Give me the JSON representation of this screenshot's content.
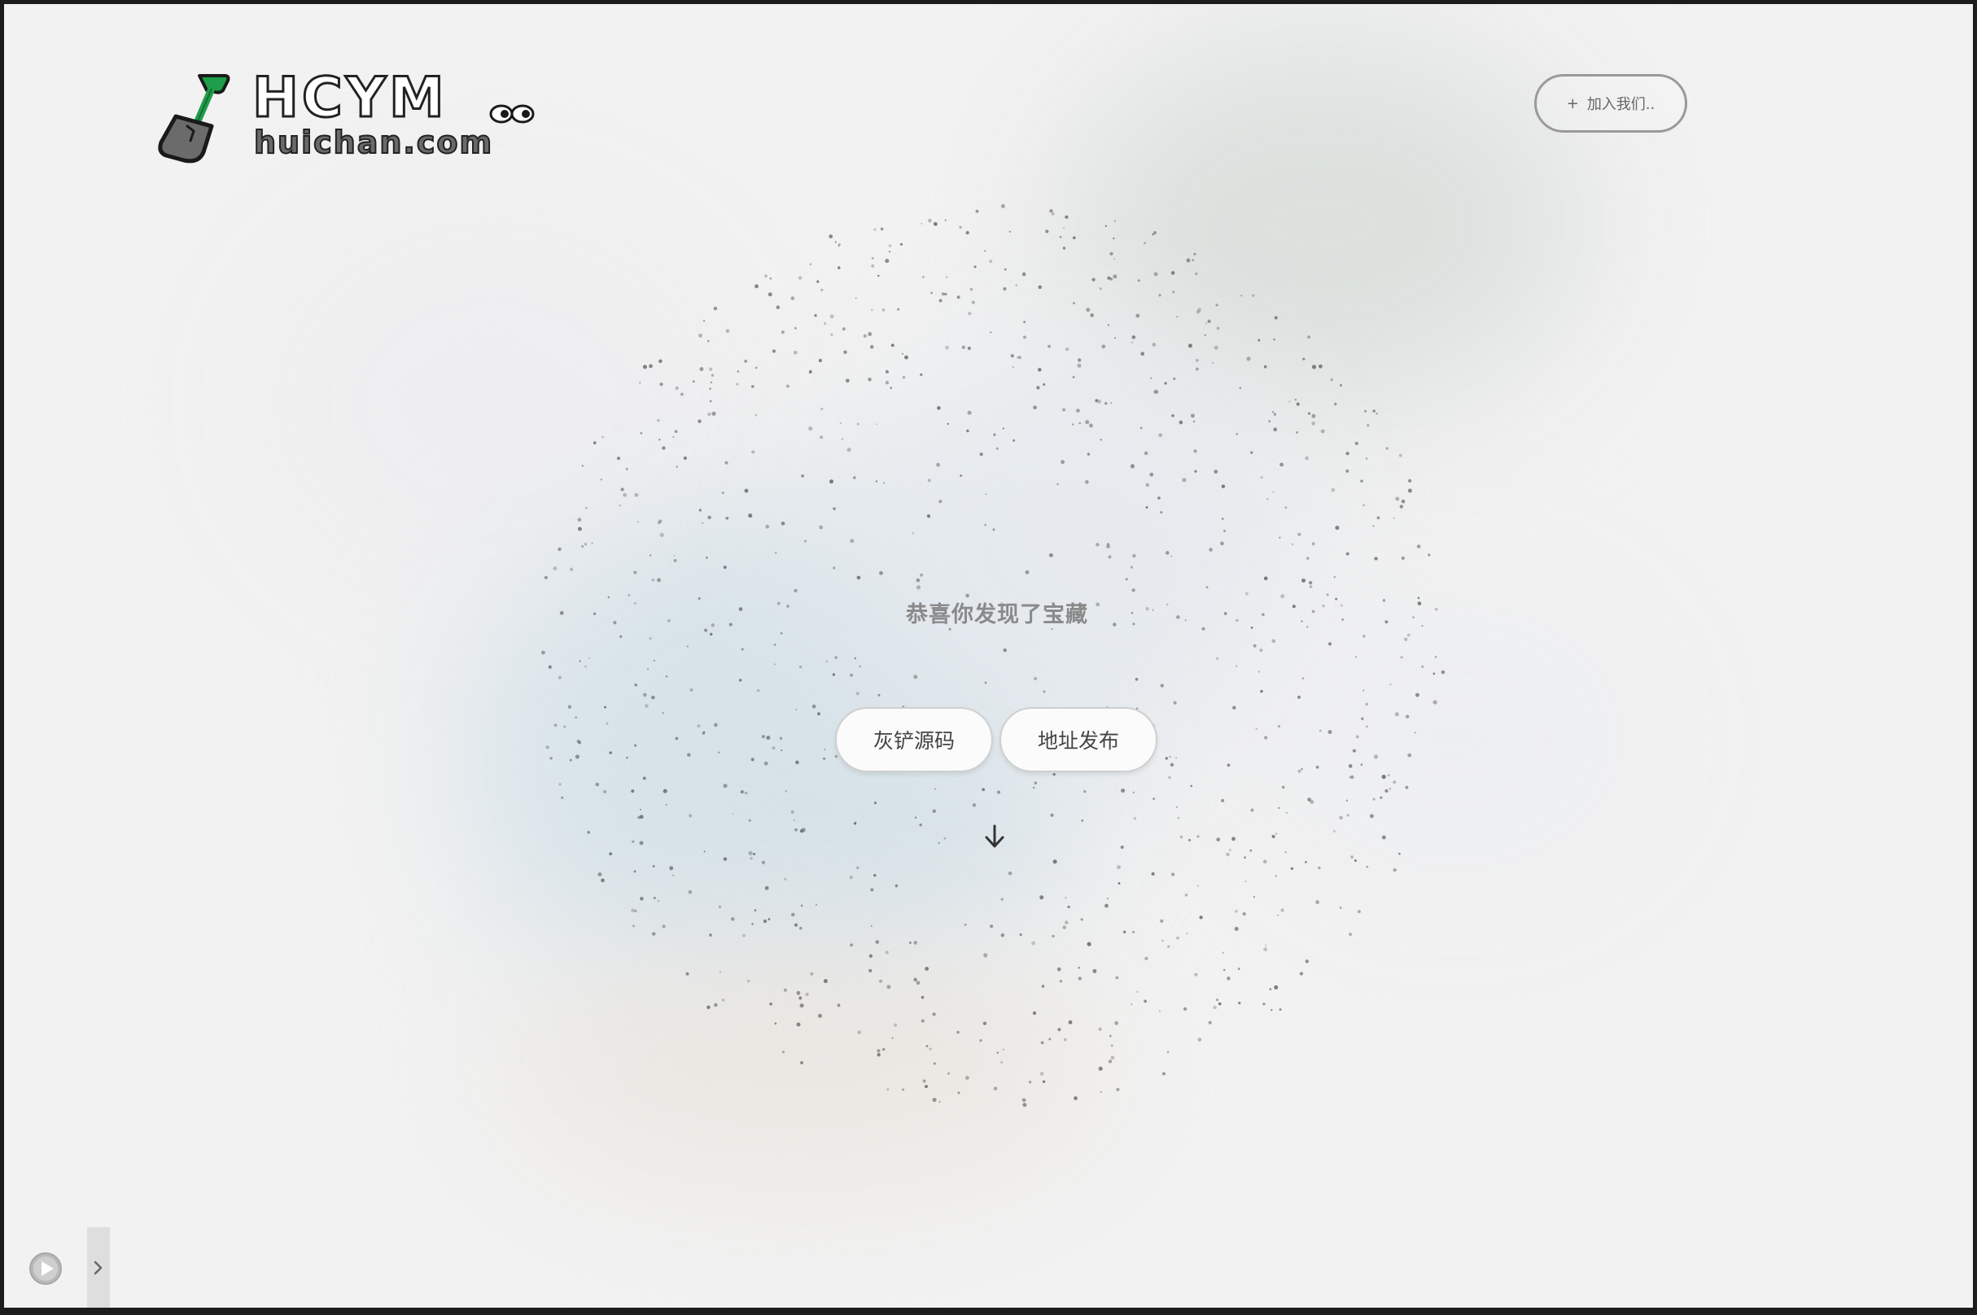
{
  "header": {
    "logo": {
      "brand": "HCYM",
      "domain": "huichan.com",
      "icon": "shovel-icon"
    },
    "join_button": {
      "icon": "plus-icon",
      "label": "加入我们.."
    }
  },
  "hero": {
    "title": "恭喜你发现了宝藏",
    "buttons": {
      "source_label": "灰铲源码",
      "address_label": "地址发布"
    },
    "scroll_icon": "arrow-down-icon"
  },
  "player": {
    "play_icon": "play-icon",
    "toggle_icon": "chevron-right-icon"
  },
  "colors": {
    "background": "#f2f2f2",
    "logo_green": "#1e9e4a",
    "text_muted": "#8a8a8a",
    "button_border": "#cfcfcf"
  }
}
